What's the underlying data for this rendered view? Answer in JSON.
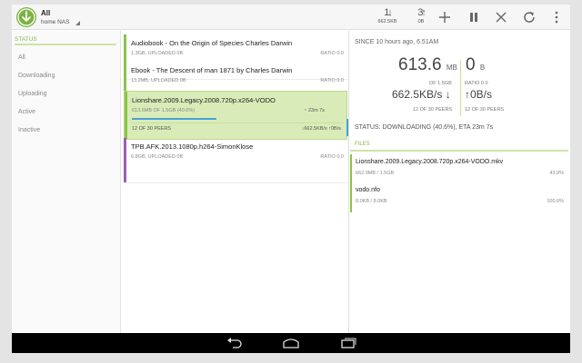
{
  "app": {
    "filter_title": "All",
    "host_name": "home NAS"
  },
  "toolbar": {
    "download_rate": "662.5KB",
    "upload_rate": "0B",
    "download_arrows": "1↓",
    "upload_arrows": "3↑",
    "actions": [
      "add-icon",
      "pause-icon",
      "close-icon",
      "refresh-icon",
      "overflow-icon"
    ]
  },
  "sidebar": {
    "header": "STATUS",
    "items": [
      {
        "label": "All"
      },
      {
        "label": "Downloading"
      },
      {
        "label": "Uploading"
      },
      {
        "label": "Active"
      },
      {
        "label": "Inactive"
      }
    ]
  },
  "torrents": [
    {
      "name": "Audiobook - On the Origin of Species  Charles Darwin",
      "size": "1.3GB, UPLOADED 0B",
      "ratio": "RATIO 0.0",
      "color": "#8bc34a"
    },
    {
      "name": "Ebook - The Descent of man 1871 by Charles Darwin",
      "size": "13.2MB, UPLOADED 0B",
      "ratio": "RATIO 0.0",
      "color": "#8bc34a"
    },
    {
      "name": "Lionshare.2009.Legacy.2008.720p.x264-VODO",
      "size": "613.6MB OF 1.5GB (40.6%)",
      "eta": "~ 23m 7s",
      "peers": "12 OF 30 PEERS",
      "speeds": "↓662.5KB/s ↑0B/s",
      "progress": 0.406,
      "color": "#8bc34a"
    },
    {
      "name": "TPB.AFK.2013.1080p.h264-SimonKlose",
      "size": "6.8GB, UPLOADED 0B",
      "ratio": "RATIO 0.0",
      "color": "#9c5fb5"
    }
  ],
  "details": {
    "since": "SINCE 10 hours ago, 6.51AM",
    "downloaded_value": "613.6",
    "downloaded_unit": "MB",
    "uploaded_value": "0",
    "uploaded_unit": "B",
    "download_of": "OF 1.5GB",
    "upload_ratio": "RATIO 0.0",
    "download_speed": "662.5KB/s ↓",
    "upload_speed": "↑0B/s",
    "download_peers": "12 OF 30 PEERS",
    "upload_peers": "12 OF 30 PEERS",
    "status": "STATUS: DOWNLOADING (40.6%), ETA 23m 7s",
    "files_header": "FILES",
    "files": [
      {
        "name": "Lionshare.2009.Legacy.2008.720p.x264-VODO.mkv",
        "size": "662.9MB / 1.5GB",
        "percent": "43.9%"
      },
      {
        "name": "vodo.nfo",
        "size": "8.0KB / 8.0KB",
        "percent": "100.0%"
      }
    ]
  },
  "colors": {
    "accent": "#8bc34a",
    "selected_bg": "#d9ecb8",
    "progress": "#4aa0d8"
  }
}
